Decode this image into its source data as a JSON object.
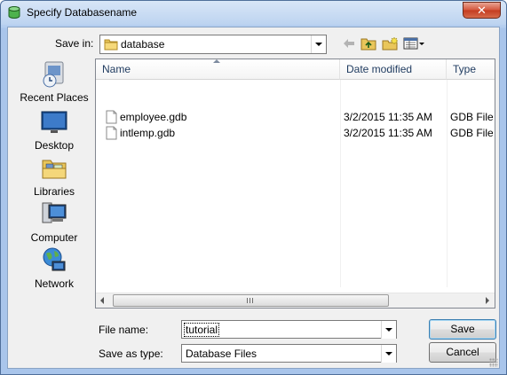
{
  "window": {
    "title": "Specify Databasename",
    "close_glyph": "✕"
  },
  "toolbar": {
    "save_in_label": "Save in:",
    "location": "database",
    "icons": [
      "back-arrow-icon",
      "up-folder-icon",
      "new-folder-icon",
      "view-menu-icon"
    ]
  },
  "places": [
    {
      "label": "Recent Places",
      "icon": "recent-places-icon"
    },
    {
      "label": "Desktop",
      "icon": "desktop-icon"
    },
    {
      "label": "Libraries",
      "icon": "libraries-icon"
    },
    {
      "label": "Computer",
      "icon": "computer-icon"
    },
    {
      "label": "Network",
      "icon": "network-icon"
    }
  ],
  "file_list": {
    "columns": [
      "Name",
      "Date modified",
      "Type"
    ],
    "rows": [
      {
        "name": "employee.gdb",
        "date": "3/2/2015 11:35 AM",
        "type": "GDB File"
      },
      {
        "name": "intlemp.gdb",
        "date": "3/2/2015 11:35 AM",
        "type": "GDB File"
      }
    ]
  },
  "form": {
    "file_name_label": "File name:",
    "file_name_value": "tutorial",
    "save_as_type_label": "Save as type:",
    "save_as_type_value": "Database Files"
  },
  "buttons": {
    "save": "Save",
    "cancel": "Cancel"
  },
  "colors": {
    "frame": "#a9c5eb",
    "client": "#f0f0f0",
    "close_button": "#c43b1f"
  }
}
